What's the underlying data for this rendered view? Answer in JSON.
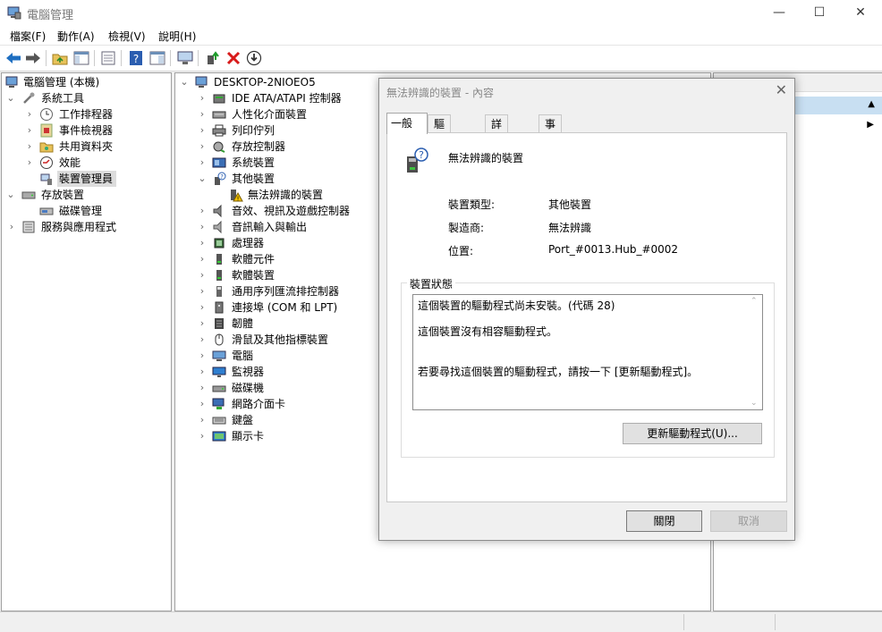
{
  "window": {
    "title": "電腦管理",
    "minimize": "—",
    "maximize": "☐",
    "close": "✕"
  },
  "menu": [
    "檔案(F)",
    "動作(A)",
    "檢視(V)",
    "說明(H)"
  ],
  "left_tree": {
    "root": "電腦管理 (本機)",
    "system_tools": "系統工具",
    "items": [
      "工作排程器",
      "事件檢視器",
      "共用資料夾",
      "效能",
      "裝置管理員"
    ],
    "storage": "存放裝置",
    "disk_mgmt": "磁碟管理",
    "services": "服務與應用程式"
  },
  "device_tree": {
    "root": "DESKTOP-2NIOEO5",
    "categories": [
      "IDE ATA/ATAPI 控制器",
      "人性化介面裝置",
      "列印佇列",
      "存放控制器",
      "系統裝置",
      "其他裝置"
    ],
    "other_child": "無法辨識的裝置",
    "categories2": [
      "音效、視訊及遊戲控制器",
      "音訊輸入與輸出",
      "處理器",
      "軟體元件",
      "軟體裝置",
      "通用序列匯流排控制器",
      "連接埠 (COM 和 LPT)",
      "韌體",
      "滑鼠及其他指標裝置",
      "電腦",
      "監視器",
      "磁碟機",
      "網路介面卡",
      "鍵盤",
      "顯示卡"
    ]
  },
  "dialog": {
    "title": "無法辨識的裝置 - 內容",
    "tabs": [
      "一般",
      "驅動程式",
      "詳細資料",
      "事件"
    ],
    "device_name": "無法辨識的裝置",
    "props": [
      {
        "label": "裝置類型:",
        "value": "其他裝置"
      },
      {
        "label": "製造商:",
        "value": "無法辨識"
      },
      {
        "label": "位置:",
        "value": "Port_#0013.Hub_#0002"
      }
    ],
    "status_group": "裝置狀態",
    "status_lines": [
      "這個裝置的驅動程式尚未安裝。(代碼 28)",
      "這個裝置沒有相容驅動程式。",
      "若要尋找這個裝置的驅動程式，請按一下 [更新驅動程式]。"
    ],
    "update_button": "更新驅動程式(U)...",
    "close_button": "關閉",
    "cancel_button": "取消"
  }
}
